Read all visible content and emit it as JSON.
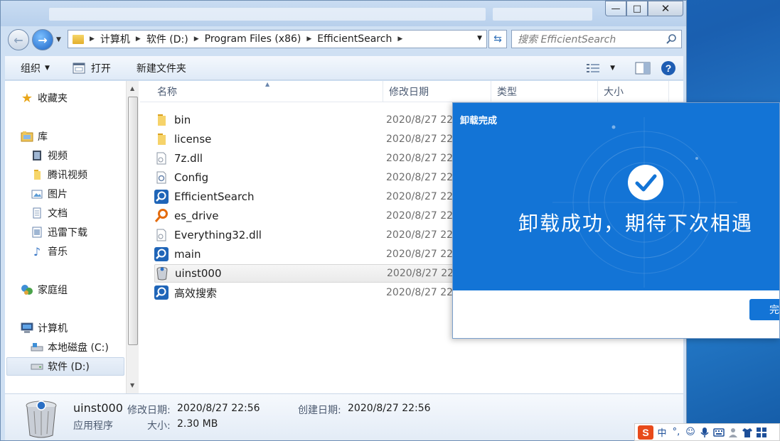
{
  "window": {
    "close_glyph": "✕",
    "maximize_glyph": "□",
    "minimize_glyph": "—"
  },
  "address": {
    "crumbs": [
      "计算机",
      "软件 (D:)",
      "Program Files (x86)",
      "EfficientSearch"
    ],
    "search_placeholder": "搜索 EfficientSearch"
  },
  "toolbar": {
    "organize": "组织",
    "open": "打开",
    "new_folder": "新建文件夹"
  },
  "sidebar": {
    "favorites": "收藏夹",
    "libraries": "库",
    "lib_items": [
      "视频",
      "腾讯视频",
      "图片",
      "文档",
      "迅雷下载",
      "音乐"
    ],
    "homegroup": "家庭组",
    "computer": "计算机",
    "drives": [
      "本地磁盘 (C:)",
      "软件 (D:)"
    ]
  },
  "columns": {
    "name": "名称",
    "modified": "修改日期",
    "type": "类型",
    "size": "大小"
  },
  "files": [
    {
      "name": "bin",
      "date": "2020/8/27 22",
      "icon": "folder-icon"
    },
    {
      "name": "license",
      "date": "2020/8/27 22",
      "icon": "folder-icon"
    },
    {
      "name": "7z.dll",
      "date": "2020/8/27 22",
      "icon": "dll-file-icon"
    },
    {
      "name": "Config",
      "date": "2020/8/27 22",
      "icon": "config-file-icon"
    },
    {
      "name": "EfficientSearch",
      "date": "2020/8/27 22",
      "icon": "search-app-icon"
    },
    {
      "name": "es_drive",
      "date": "2020/8/27 22",
      "icon": "key-app-icon"
    },
    {
      "name": "Everything32.dll",
      "date": "2020/8/27 22",
      "icon": "dll-file-icon"
    },
    {
      "name": "main",
      "date": "2020/8/27 22",
      "icon": "search-app-icon"
    },
    {
      "name": "uinst000",
      "date": "2020/8/27 22",
      "icon": "trash-app-icon"
    },
    {
      "name": "高效搜索",
      "date": "2020/8/27 22",
      "icon": "search-app-icon"
    }
  ],
  "selected_file_index": 8,
  "details": {
    "name": "uinst000",
    "type": "应用程序",
    "modified_label": "修改日期:",
    "modified_value": "2020/8/27 22:56",
    "created_label": "创建日期:",
    "created_value": "2020/8/27 22:56",
    "size_label": "大小:",
    "size_value": "2.30 MB"
  },
  "dialog": {
    "title": "卸载完成",
    "message": "卸载成功，期待下次相遇",
    "finish_button": "完成"
  },
  "ime": {
    "mode": "中",
    "punct": "°,"
  },
  "colors": {
    "dialog_blue": "#1374d6",
    "explorer_frame": "#cfe0f3"
  }
}
